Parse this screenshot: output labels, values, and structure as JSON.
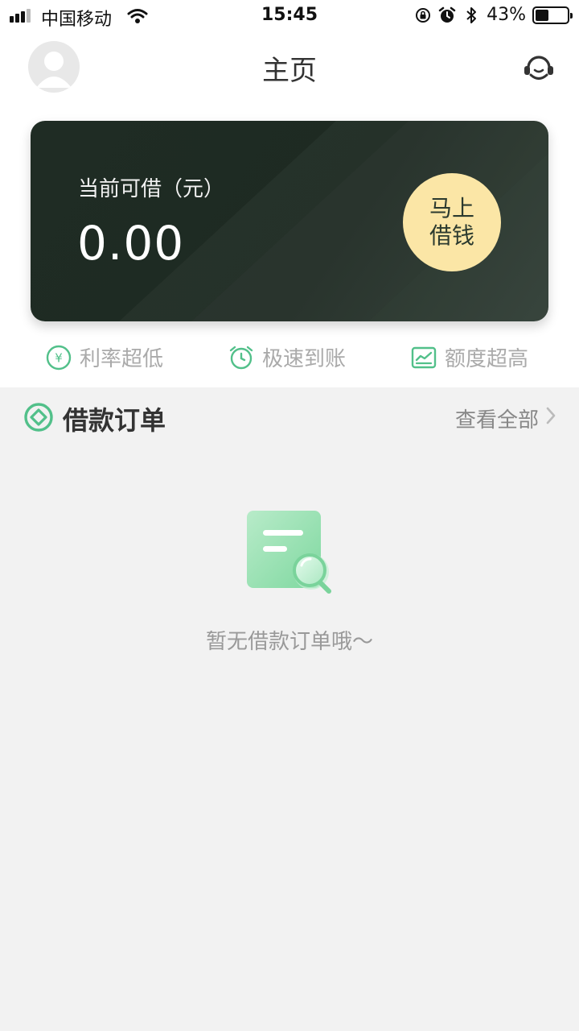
{
  "status_bar": {
    "carrier": "中国移动",
    "time": "15:45",
    "battery_percent": "43%",
    "battery_level": 0.43,
    "icons": [
      "signal-icon",
      "wifi-icon",
      "rotation-lock-icon",
      "alarm-icon",
      "bluetooth-icon",
      "battery-icon"
    ]
  },
  "nav": {
    "title": "主页",
    "left_icon": "avatar-icon",
    "right_icon": "customer-service-icon"
  },
  "card": {
    "label": "当前可借（元）",
    "amount": "0.00",
    "button_line1": "马上",
    "button_line2": "借钱"
  },
  "features": [
    {
      "icon": "yen-icon",
      "label": "利率超低"
    },
    {
      "icon": "clock-icon",
      "label": "极速到账"
    },
    {
      "icon": "chart-icon",
      "label": "额度超高"
    }
  ],
  "orders": {
    "title": "借款订单",
    "view_all": "查看全部",
    "empty_text": "暂无借款订单哦～"
  },
  "colors": {
    "accent_green": "#52c08a",
    "card_dark": "#1f2c24",
    "button_yellow": "#fbe6a6",
    "background": "#f2f2f2"
  }
}
